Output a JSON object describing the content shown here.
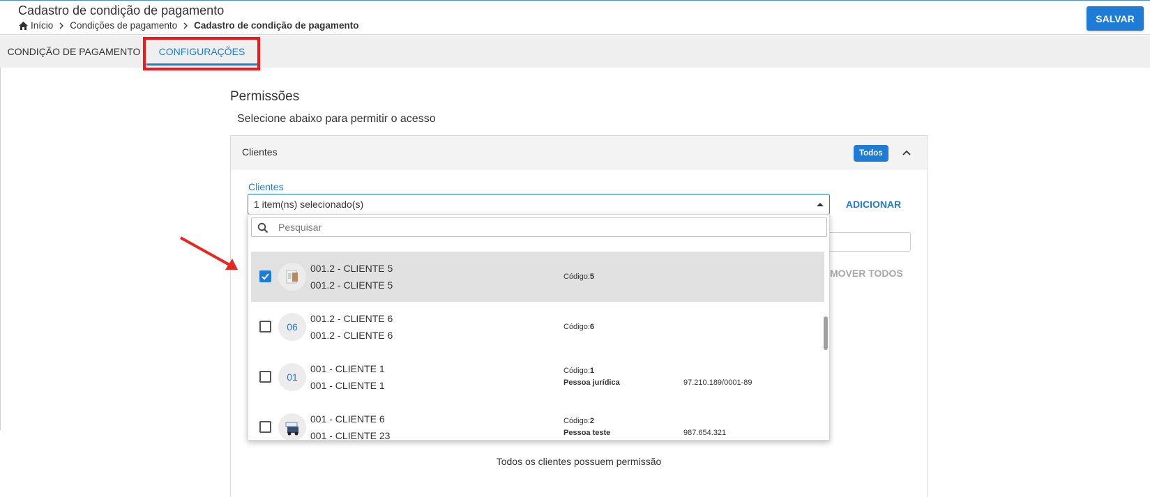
{
  "header": {
    "title": "Cadastro de condição de pagamento",
    "breadcrumb": {
      "home": "Início",
      "parent": "Condições de pagamento",
      "current": "Cadastro de condição de pagamento"
    },
    "save_label": "SALVAR"
  },
  "tabs": [
    {
      "label": "CONDIÇÃO DE PAGAMENTO",
      "active": false
    },
    {
      "label": "CONFIGURAÇÕES",
      "active": true
    }
  ],
  "permissions": {
    "title": "Permissões",
    "subtitle": "Selecione abaixo para permitir o acesso",
    "panel": {
      "label": "Clientes",
      "badge": "Todos",
      "field_label": "Clientes",
      "select_value": "1 item(ns) selecionado(s)",
      "add_label": "ADICIONAR",
      "remove_all_label": "MOVER TODOS",
      "footer_note": "Todos os clientes possuem permissão"
    }
  },
  "dropdown": {
    "search_placeholder": "Pesquisar",
    "items": [
      {
        "checked": true,
        "avatar": "",
        "avatar_type": "image",
        "line1": "001.2 - CLIENTE 5",
        "line2": "001.2 - CLIENTE 5",
        "code_label": "Código:",
        "code": "5",
        "extra_label": "",
        "extra_value": ""
      },
      {
        "checked": false,
        "avatar": "06",
        "avatar_type": "text",
        "line1": "001.2 - CLIENTE 6",
        "line2": "001.2 - CLIENTE 6",
        "code_label": "Código:",
        "code": "6",
        "extra_label": "",
        "extra_value": ""
      },
      {
        "checked": false,
        "avatar": "01",
        "avatar_type": "text",
        "line1": "001 - CLIENTE 1",
        "line2": "001 - CLIENTE 1",
        "code_label": "Código:",
        "code": "1",
        "extra_label": "Pessoa jurídica",
        "extra_value": "97.210.189/0001-89"
      },
      {
        "checked": false,
        "avatar": "",
        "avatar_type": "image",
        "line1": "001 - CLIENTE 6",
        "line2": "001 - CLIENTE 23",
        "code_label": "Código:",
        "code": "2",
        "extra_label": "Pessoa teste",
        "extra_value": "987.654.321"
      }
    ]
  },
  "colors": {
    "accent": "#1e7bd6",
    "highlight": "#f01818",
    "selected_row": "#e1e1e1"
  }
}
